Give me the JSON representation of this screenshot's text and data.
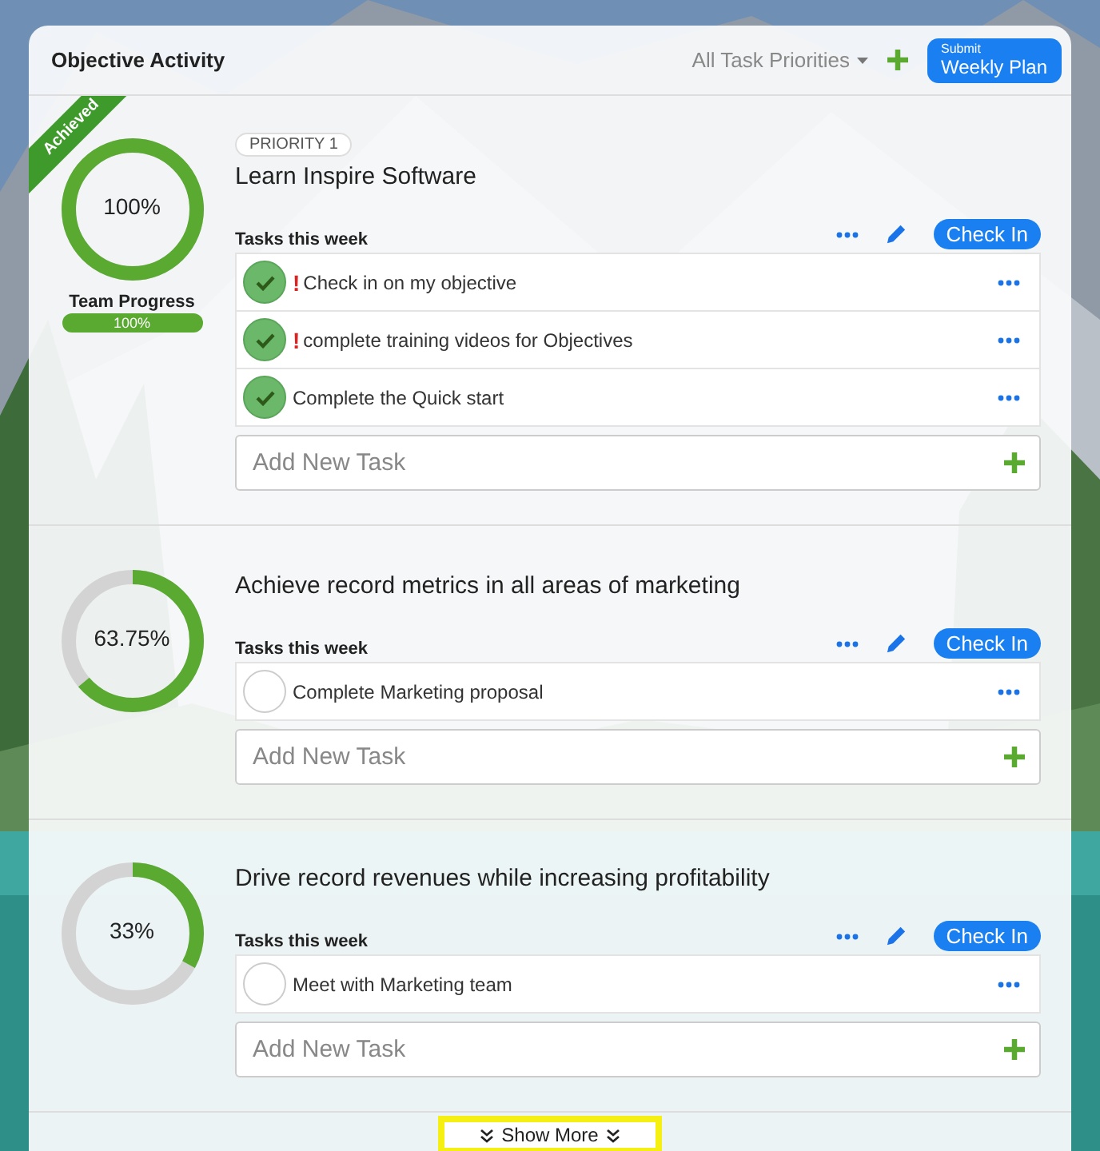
{
  "header": {
    "title": "Objective Activity",
    "filter": "All Task Priorities",
    "submit": {
      "small": "Submit",
      "label": "Weekly Plan"
    }
  },
  "objectives": [
    {
      "priority": "PRIORITY 1",
      "title": "Learn Inspire Software",
      "percent": "100%",
      "level": 1,
      "achieved": true,
      "badge": "Achieved",
      "team_progress": {
        "label": "Team Progress",
        "reading": "100%",
        "level": 1
      },
      "tasks_label": "Tasks this week",
      "check_in": "Check In",
      "tasks": [
        {
          "text": "Check in on my objective",
          "done": true,
          "urgent": true,
          "mark": "!"
        },
        {
          "text": "complete training videos for Objectives",
          "done": true,
          "urgent": true,
          "mark": "!"
        },
        {
          "text": "Complete the Quick start",
          "done": true,
          "urgent": false
        }
      ],
      "add_placeholder": "Add New Task"
    },
    {
      "title": "Achieve record metrics in all areas of marketing",
      "percent": "63.75%",
      "level": 0.6375,
      "achieved": false,
      "tasks_label": "Tasks this week",
      "check_in": "Check In",
      "tasks": [
        {
          "text": "Complete Marketing proposal",
          "done": false,
          "urgent": false
        }
      ],
      "add_placeholder": "Add New Task"
    },
    {
      "title": "Drive record revenues while increasing profitability",
      "percent": "33%",
      "level": 0.33,
      "achieved": false,
      "tasks_label": "Tasks this week",
      "check_in": "Check In",
      "tasks": [
        {
          "text": "Meet with Marketing team",
          "done": false,
          "urgent": false
        }
      ],
      "add_placeholder": "Add New Task"
    }
  ],
  "show_more": "Show More"
}
